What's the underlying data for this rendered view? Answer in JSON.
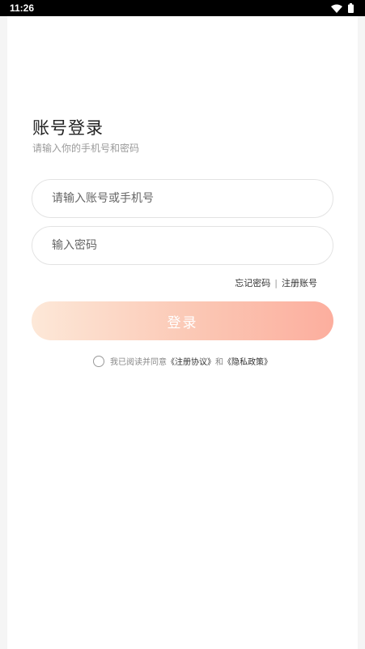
{
  "status_bar": {
    "time": "11:26",
    "icons": [
      "wifi-icon",
      "battery-icon"
    ]
  },
  "login": {
    "title": "账号登录",
    "subtitle": "请输入你的手机号和密码",
    "phone_placeholder": "请输入账号或手机号",
    "password_placeholder": "输入密码",
    "forgot_password": "忘记密码",
    "separator": "|",
    "register": "注册账号",
    "submit": "登录"
  },
  "agreement": {
    "prefix": "我已阅读并同意",
    "register_agreement": "《注册协议》",
    "conjunction": "和",
    "privacy_policy": "《隐私政策》",
    "checked": false
  },
  "colors": {
    "button_gradient_start": "#fde8d8",
    "button_gradient_end": "#fcae9e",
    "status_bar": "#000000",
    "background": "#f5f5f5"
  }
}
